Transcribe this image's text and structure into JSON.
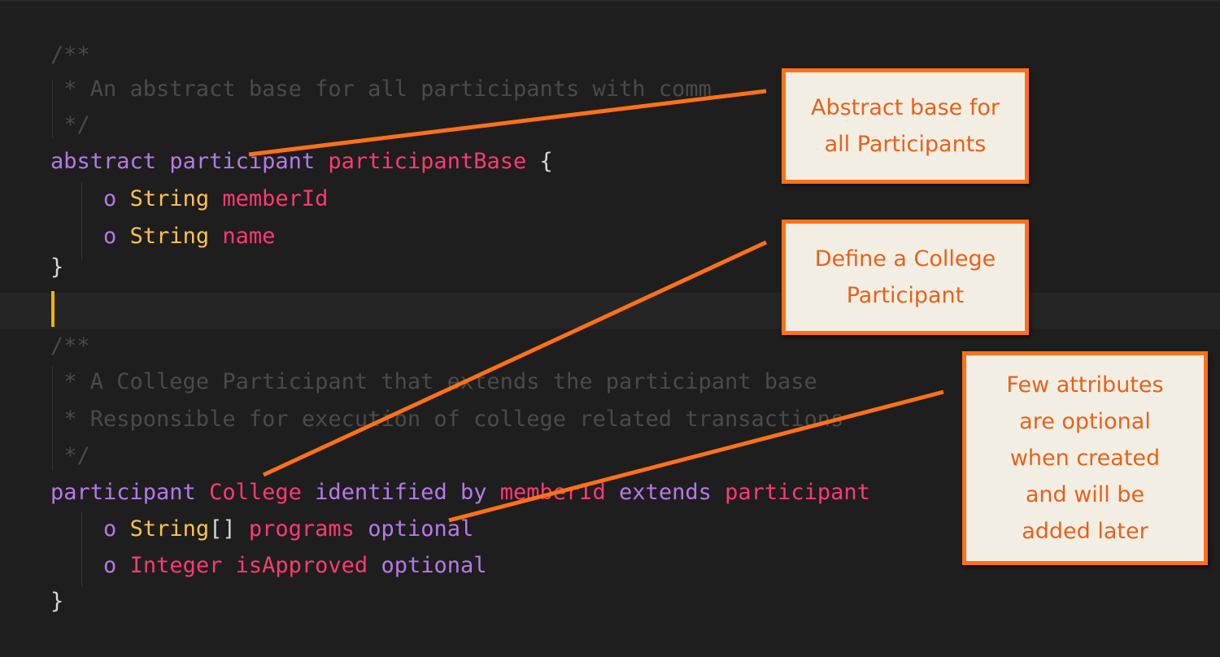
{
  "code": {
    "comment1": [
      "/**",
      " * An abstract base for all participants with comm",
      " */"
    ],
    "line_abstract": {
      "kw1": "abstract",
      "kw2": "participant",
      "name": "participantBase",
      "brace": "{"
    },
    "line_memberId": {
      "o": "o",
      "type": "String",
      "name": "memberId"
    },
    "line_name": {
      "o": "o",
      "type": "String",
      "name": "name"
    },
    "close1": "}",
    "comment2": [
      "/**",
      " * A College Participant that extends the participant base",
      " * Responsible for execution of college related transactions",
      " */"
    ],
    "line_college": {
      "kw1": "participant",
      "name": "College",
      "kw2": "identified by",
      "ref": "memberId",
      "kw3": "extends",
      "base": "participant"
    },
    "line_programs": {
      "o": "o",
      "type": "String",
      "brackets": "[]",
      "name": "programs",
      "mod": "optional"
    },
    "line_approved": {
      "o": "o",
      "type": "Integer",
      "name": "isApproved",
      "mod": "optional"
    },
    "close2": "}"
  },
  "callouts": {
    "abstract_base": [
      "Abstract base for",
      "all Participants"
    ],
    "college": [
      "Define a College",
      "Participant"
    ],
    "optional": [
      "Few attributes",
      "are optional",
      "when created",
      "and will be",
      "added later"
    ]
  },
  "colors": {
    "background": "#1e1e1e",
    "keyword": "#b679e8",
    "type": "#ffc24f",
    "name": "#ff3a6e",
    "comment": "#4a4a4a",
    "callout_border": "#ff7117",
    "callout_text": "#e8621a",
    "callout_bg": "#f3eee3",
    "cursor": "#f0b400"
  }
}
